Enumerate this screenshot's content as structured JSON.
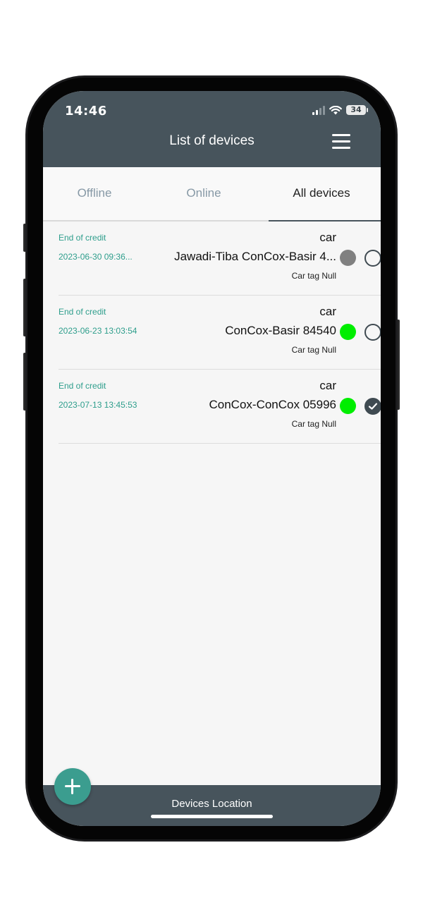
{
  "status_bar": {
    "time": "14:46",
    "battery": "34"
  },
  "header": {
    "title": "List of devices",
    "menu_icon": "hamburger-menu-icon"
  },
  "tabs": [
    {
      "label": "Offline",
      "active": false
    },
    {
      "label": "Online",
      "active": false
    },
    {
      "label": "All devices",
      "active": true
    }
  ],
  "devices": [
    {
      "credit": "End of credit",
      "date": "2023-06-30 09:36...",
      "type": "car",
      "name": "Jawadi-Tiba ConCox-Basir 4...",
      "tag": "Car tag Null",
      "status_color": "#808080",
      "selected": false
    },
    {
      "credit": "End of credit",
      "date": "2023-06-23 13:03:54",
      "type": "car",
      "name": "ConCox-Basir 84540",
      "tag": "Car tag Null",
      "status_color": "#00ee00",
      "selected": false
    },
    {
      "credit": "End of credit",
      "date": "2023-07-13 13:45:53",
      "type": "car",
      "name": "ConCox-ConCox 05996",
      "tag": "Car tag Null",
      "status_color": "#00ee00",
      "selected": true
    }
  ],
  "bottom_bar": {
    "label": "Devices Location"
  },
  "fab": {
    "icon": "plus-icon"
  },
  "colors": {
    "header": "#47545c",
    "accent": "#2e9e8c",
    "online": "#00ee00",
    "offline": "#808080"
  }
}
